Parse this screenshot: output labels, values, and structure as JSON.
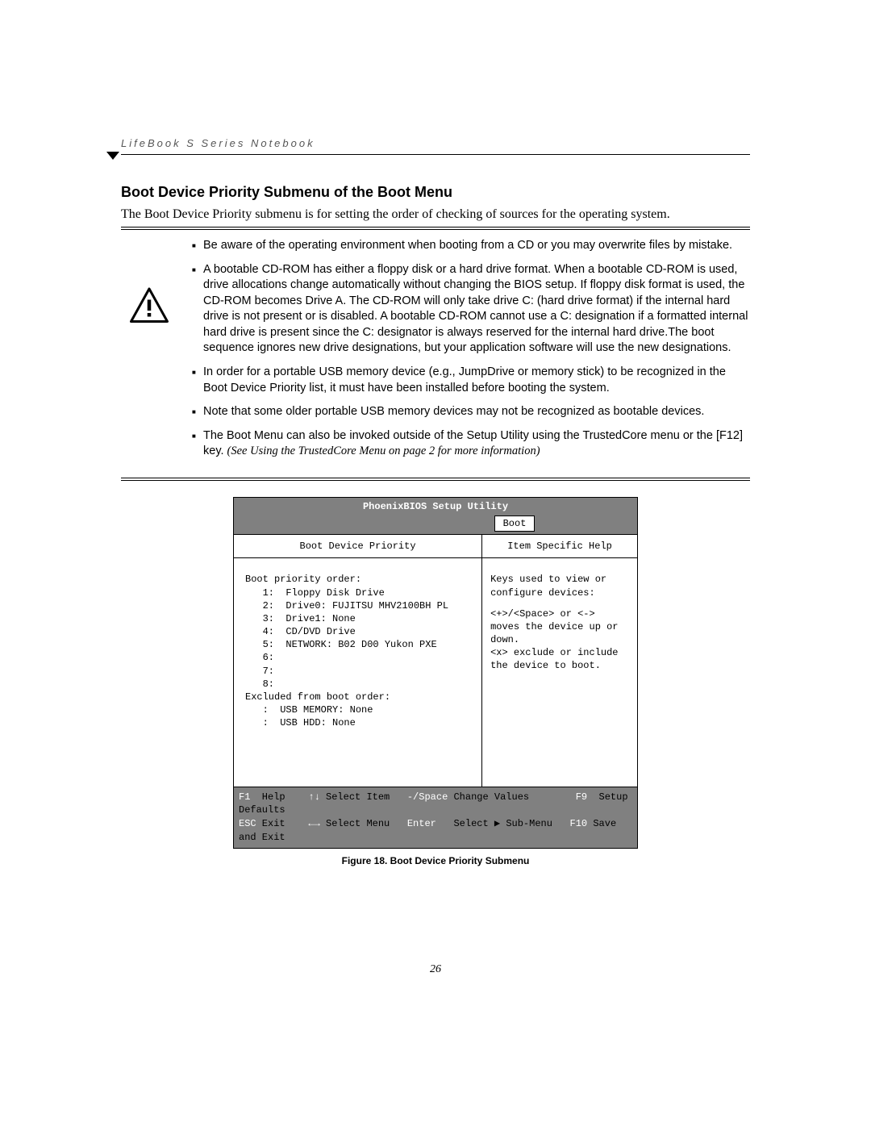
{
  "running_head": "LifeBook S Series Notebook",
  "section_title": "Boot Device Priority Submenu of the Boot Menu",
  "intro": "The Boot Device Priority submenu is for setting the order of checking of sources for the operating system.",
  "bullets": {
    "b1": "Be aware of the operating environment when booting from a CD or you may overwrite files by mistake.",
    "b2": "A bootable CD-ROM has either a floppy disk or a hard drive format. When a bootable CD-ROM is used, drive allocations change automatically without changing the BIOS setup. If floppy disk format is used, the CD-ROM becomes Drive A. The CD-ROM will only take drive C: (hard drive format) if the internal hard drive is not present or is disabled. A bootable CD-ROM cannot use a C: designation if a formatted internal hard drive is present since the C: designator is always reserved for the internal hard drive.The boot sequence ignores new drive designations, but your application software will use the new designations.",
    "b3": "In order for a portable USB memory device (e.g., JumpDrive or memory stick) to be recognized in the Boot Device Priority list, it must have been installed before booting the system.",
    "b4": "Note that some older portable USB memory devices may not be recognized as bootable devices.",
    "b5_text": "The Boot Menu can also be invoked outside of the Setup Utility using the TrustedCore menu or the [F12] key. ",
    "b5_italic": "(See Using the TrustedCore Menu on page 2 for more information)"
  },
  "bios": {
    "title": "PhoenixBIOS Setup Utility",
    "tab": "Boot",
    "left_head": "Boot Device Priority",
    "right_head": "Item Specific Help",
    "priority_label": "Boot priority order:",
    "items": [
      "1:  Floppy Disk Drive",
      "2:  Drive0: FUJITSU MHV2100BH PL",
      "3:  Drive1: None",
      "4:  CD/DVD Drive",
      "5:  NETWORK: B02 D00 Yukon PXE",
      "6:",
      "7:",
      "8:"
    ],
    "excluded_label": "Excluded from boot order:",
    "excluded": [
      ":  USB MEMORY: None",
      ":  USB HDD: None"
    ],
    "help_lines": [
      "Keys used to view or configure devices:",
      "<+>/<Space> or <-> moves the device up or down.",
      "<x> exclude or include the device to boot."
    ],
    "footer": {
      "f1": "F1",
      "help": "Help",
      "updown": "↑↓",
      "select_item": "Select Item",
      "minus_space": "-/Space",
      "change_values": "Change Values",
      "f9": "F9",
      "setup_defaults": "Setup Defaults",
      "esc": "ESC",
      "exit": "Exit",
      "leftright": "←→",
      "select_menu": "Select Menu",
      "enter": "Enter",
      "select_sub": "Select ▶ Sub-Menu",
      "f10": "F10",
      "save_exit": "Save and Exit"
    }
  },
  "figure_caption": "Figure 18.  Boot Device Priority Submenu",
  "page_number": "26"
}
